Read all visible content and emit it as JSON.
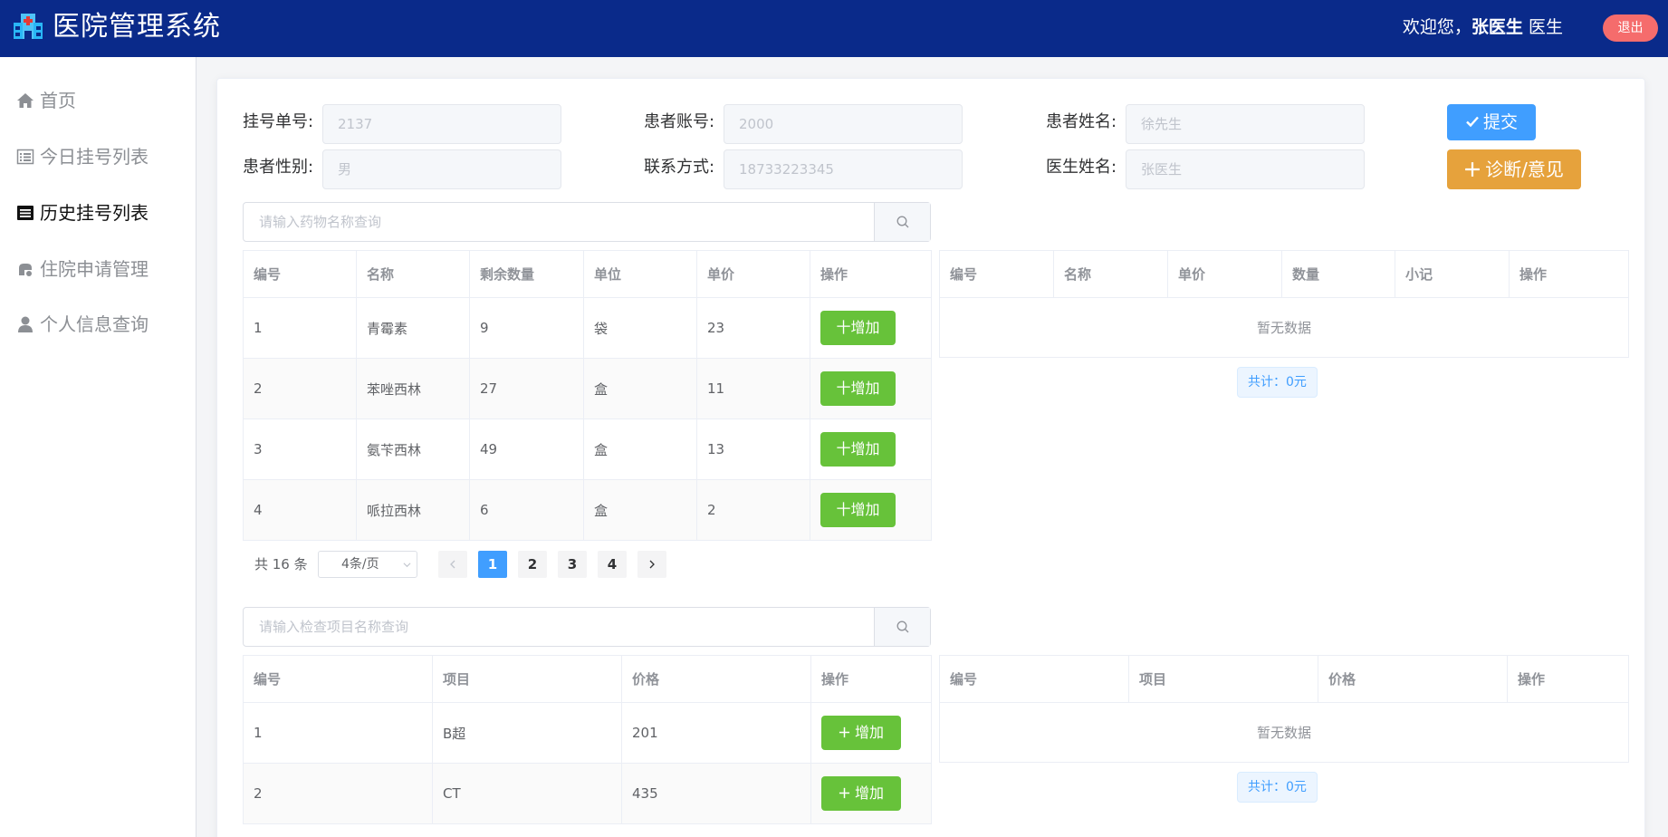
{
  "header": {
    "title": "医院管理系统",
    "welcome_prefix": "欢迎您，",
    "user_name": "张医生",
    "role": "医生",
    "logout_label": "退出"
  },
  "sidebar": {
    "items": [
      {
        "label": "首页",
        "icon": "home-icon"
      },
      {
        "label": "今日挂号列表",
        "icon": "list-icon"
      },
      {
        "label": "历史挂号列表",
        "icon": "history-list-icon",
        "active": true
      },
      {
        "label": "住院申请管理",
        "icon": "hospital-icon"
      },
      {
        "label": "个人信息查询",
        "icon": "user-icon"
      }
    ]
  },
  "form": {
    "fields": [
      {
        "label": "挂号单号:",
        "value": "2137"
      },
      {
        "label": "患者账号:",
        "value": "2000"
      },
      {
        "label": "患者姓名:",
        "value": "徐先生"
      },
      {
        "label": "患者性别:",
        "value": "男"
      },
      {
        "label": "联系方式:",
        "value": "18733223345"
      },
      {
        "label": "医生姓名:",
        "value": "张医生"
      }
    ],
    "submit_label": "提交",
    "diagnosis_label": "诊断/意见"
  },
  "drug_search": {
    "placeholder": "请输入药物名称查询"
  },
  "drug_table": {
    "headers": [
      "编号",
      "名称",
      "剩余数量",
      "单位",
      "单价",
      "操作"
    ],
    "rows": [
      {
        "id": "1",
        "name": "青霉素",
        "qty": "9",
        "unit": "袋",
        "price": "23"
      },
      {
        "id": "2",
        "name": "苯唑西林",
        "qty": "27",
        "unit": "盒",
        "price": "11"
      },
      {
        "id": "3",
        "name": "氨苄西林",
        "qty": "49",
        "unit": "盒",
        "price": "13"
      },
      {
        "id": "4",
        "name": "哌拉西林",
        "qty": "6",
        "unit": "盒",
        "price": "2"
      }
    ],
    "add_label": "十增加"
  },
  "selected_drugs": {
    "headers": [
      "编号",
      "名称",
      "单价",
      "数量",
      "小记",
      "操作"
    ],
    "empty_text": "暂无数据",
    "total": "共计：0元"
  },
  "pagination": {
    "total_text": "共 16 条",
    "page_size": "4条/页",
    "pages": [
      "1",
      "2",
      "3",
      "4"
    ],
    "current": "1"
  },
  "check_search": {
    "placeholder": "请输入检查项目名称查询"
  },
  "check_table": {
    "headers": [
      "编号",
      "项目",
      "价格",
      "操作"
    ],
    "rows": [
      {
        "id": "1",
        "item": "B超",
        "price": "201"
      },
      {
        "id": "2",
        "item": "CT",
        "price": "435"
      }
    ],
    "add_label": "增加"
  },
  "selected_checks": {
    "headers": [
      "编号",
      "项目",
      "价格",
      "操作"
    ],
    "empty_text": "暂无数据",
    "total": "共计：0元"
  },
  "colors": {
    "header_bg": "#0a2a8a",
    "primary": "#409eff",
    "success": "#67c23a",
    "warning": "#e6a23c",
    "danger": "#f56c6c"
  }
}
